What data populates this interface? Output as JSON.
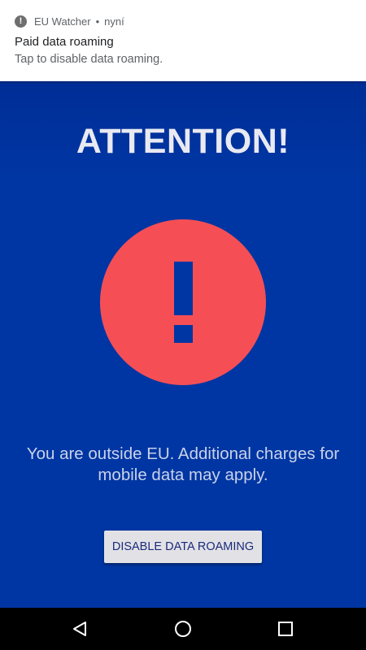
{
  "notification": {
    "app_name": "EU Watcher",
    "separator": "•",
    "time": "nyní",
    "title": "Paid data roaming",
    "text": "Tap to disable data roaming.",
    "icon": "alert-circle-icon"
  },
  "main": {
    "heading": "ATTENTION!",
    "icon": "exclamation-circle-icon",
    "message": "You are outside EU. Additional charges for mobile data may apply.",
    "button_label": "DISABLE DATA ROAMING"
  },
  "colors": {
    "background": "#0036a3",
    "alert_circle": "#f54f55",
    "heading": "#e9e9f2",
    "button": "#e2e2e6",
    "button_text": "#1b2a7a"
  },
  "navbar": {
    "back_icon": "back-triangle-icon",
    "home_icon": "home-circle-icon",
    "recents_icon": "recents-square-icon"
  }
}
